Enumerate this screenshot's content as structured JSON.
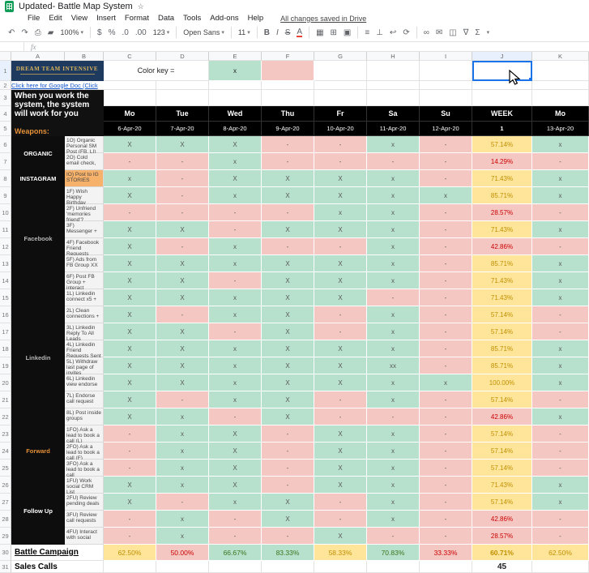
{
  "titlebar": {
    "title": "Updated-  Battle Map System"
  },
  "menubar": {
    "items": [
      "File",
      "Edit",
      "View",
      "Insert",
      "Format",
      "Data",
      "Tools",
      "Add-ons",
      "Help"
    ],
    "saved_status": "All changes saved in Drive"
  },
  "toolbar": {
    "zoom": "100%",
    "font_name": "Open Sans",
    "font_size": "11"
  },
  "formula": {
    "fx": "fx"
  },
  "icons": {
    "star": "☆",
    "undo": "↶",
    "redo": "↷",
    "print": "⎙",
    "paint_format": "▰",
    "dollar": "$",
    "percent": "%",
    "dec_decrease": ".0",
    "dec_increase": ".00",
    "format_123": "123",
    "caret": "▾",
    "bold": "B",
    "italic": "I",
    "strikethrough": "S",
    "text_color": "A",
    "fill_color": "▦",
    "borders": "⊞",
    "merge_cells": "▣",
    "align_horizontal": "≡",
    "align_vertical": "⊥",
    "text_wrap": "↩",
    "text_rotate": "⟳",
    "insert_link": "∞",
    "insert_comment": "✉",
    "insert_chart": "◫",
    "filter": "∇",
    "functions": "Σ"
  },
  "colors": {
    "green": "#b7e1cd",
    "pink": "#f4c7c3",
    "yellow": "#ffe599",
    "selection": "#1a73e8",
    "link": "#1155cc",
    "orange_label": "#e69138",
    "instagram_bg": "#f6b26b",
    "navy": "#1f3a5f",
    "gold": "#d9b45b"
  },
  "sheet": {
    "col_headers": [
      "A",
      "B",
      "C",
      "D",
      "E",
      "F",
      "G",
      "H",
      "I",
      "J",
      "K"
    ],
    "color_key_label": "Color key =",
    "color_key_x": "x",
    "logo_text": "DREAM TEAM INTENSIVE",
    "link_text": "Click here for Google Doc (Click",
    "quote": "When you work the system, the system will work for you",
    "weapons_label": "Weapons:",
    "day_headers": [
      "Mo",
      "Tue",
      "Wed",
      "Thu",
      "Fr",
      "Sa",
      "Su",
      "WEEK",
      "Mo"
    ],
    "date_row": [
      "6-Apr-20",
      "7-Apr-20",
      "8-Apr-20",
      "9-Apr-20",
      "10-Apr-20",
      "11-Apr-20",
      "12-Apr-20",
      "1",
      "13-Apr-20"
    ],
    "rows": [
      {
        "num": "6",
        "group": "ORGANIC",
        "group_span": 2,
        "group_color": "#ffffff",
        "weapon": "1O) Organic Personal SM Post (FB, LI)",
        "cells": [
          "X",
          "X",
          "X",
          "-",
          "-",
          "x",
          "-"
        ],
        "week": "57.14%",
        "week_tone": "yellow",
        "mon2": "x"
      },
      {
        "num": "7",
        "weapon": "2O) Cold email check,",
        "cells": [
          "-",
          "-",
          "x",
          "-",
          "-",
          "-",
          "-"
        ],
        "week": "14.29%",
        "week_tone": "pink",
        "mon2": "-"
      },
      {
        "num": "8",
        "group": "INSTAGRAM",
        "group_span": 1,
        "group_color": "#ffffff",
        "weapon": "IO) Post to IG STORIES",
        "weapon_bg": "orange",
        "cells": [
          "x",
          "-",
          "X",
          "X",
          "X",
          "x",
          "-"
        ],
        "week": "71.43%",
        "week_tone": "yellow",
        "mon2": "x"
      },
      {
        "num": "9",
        "group": "Facebook",
        "group_span": 6,
        "group_color": "#b7b7b7",
        "weapon": "1F) Wish Happy Birthday",
        "cells": [
          "X",
          "-",
          "x",
          "X",
          "X",
          "x",
          "x"
        ],
        "week": "85.71%",
        "week_tone": "yellow",
        "mon2": "x"
      },
      {
        "num": "10",
        "weapon": "2F) Unfriend 'memories friend'?",
        "cells": [
          "-",
          "-",
          "-",
          "-",
          "x",
          "x",
          "-"
        ],
        "week": "28.57%",
        "week_tone": "pink",
        "mon2": "-"
      },
      {
        "num": "11",
        "weapon": "3F) Messenger +",
        "cells": [
          "X",
          "X",
          "-",
          "X",
          "X",
          "x",
          "-"
        ],
        "week": "71.43%",
        "week_tone": "yellow",
        "mon2": "x"
      },
      {
        "num": "12",
        "weapon": "4F) Facebook Friend Requests",
        "cells": [
          "X",
          "-",
          "x",
          "-",
          "-",
          "x",
          "-"
        ],
        "week": "42.86%",
        "week_tone": "pink",
        "mon2": "-"
      },
      {
        "num": "13",
        "weapon": "5F) Ads from FB Group XX",
        "cells": [
          "X",
          "X",
          "x",
          "X",
          "X",
          "x",
          "-"
        ],
        "week": "85.71%",
        "week_tone": "yellow",
        "mon2": "x"
      },
      {
        "num": "14",
        "weapon": "6F) Post FB Group + interact",
        "cells": [
          "X",
          "X",
          "-",
          "X",
          "X",
          "x",
          "-"
        ],
        "week": "71.43%",
        "week_tone": "yellow",
        "mon2": "x"
      },
      {
        "num": "15",
        "group": "Linkedin",
        "group_span": 8,
        "group_color": "#b7b7b7",
        "weapon": "1L) Linkedin connect x5 +",
        "cells": [
          "X",
          "X",
          "x",
          "X",
          "X",
          "-",
          "-"
        ],
        "week": "71.43%",
        "week_tone": "yellow",
        "mon2": "x"
      },
      {
        "num": "16",
        "weapon": "2L) Clean connections +",
        "cells": [
          "X",
          "-",
          "x",
          "X",
          "-",
          "x",
          "-"
        ],
        "week": "57.14%",
        "week_tone": "yellow",
        "mon2": "-"
      },
      {
        "num": "17",
        "weapon": "3L) Linkedin Reply To All Leads",
        "cells": [
          "X",
          "X",
          "-",
          "X",
          "-",
          "x",
          "-"
        ],
        "week": "57.14%",
        "week_tone": "yellow",
        "mon2": "-"
      },
      {
        "num": "18",
        "weapon": "4L) Linkedin Friend Requests Sent",
        "cells": [
          "X",
          "X",
          "x",
          "X",
          "X",
          "x",
          "-"
        ],
        "week": "85.71%",
        "week_tone": "yellow",
        "mon2": "x"
      },
      {
        "num": "19",
        "weapon": "5L) Withdraw last page of invites",
        "cells": [
          "X",
          "X",
          "x",
          "X",
          "X",
          "xx",
          "-"
        ],
        "week": "85.71%",
        "week_tone": "yellow",
        "mon2": "x"
      },
      {
        "num": "20",
        "weapon": "6L) Linkedin view endorse",
        "cells": [
          "X",
          "X",
          "x",
          "X",
          "X",
          "x",
          "x"
        ],
        "week": "100.00%",
        "week_tone": "yellow",
        "mon2": "x"
      },
      {
        "num": "21",
        "weapon": "7L) Endorse call request",
        "cells": [
          "X",
          "-",
          "x",
          "X",
          "-",
          "x",
          "-"
        ],
        "week": "57.14%",
        "week_tone": "yellow",
        "mon2": "-"
      },
      {
        "num": "22",
        "weapon": "8L) Post inside groups",
        "cells": [
          "X",
          "x",
          "-",
          "X",
          "-",
          "-",
          "-"
        ],
        "week": "42.86%",
        "week_tone": "pink",
        "mon2": "x"
      },
      {
        "num": "23",
        "group": "Forward",
        "group_span": 3,
        "group_color": "#e69138",
        "weapon": "1FO) Ask a lead to book a call (L)",
        "cells": [
          "-",
          "x",
          "X",
          "-",
          "X",
          "x",
          "-"
        ],
        "week": "57.14%",
        "week_tone": "yellow",
        "mon2": "-"
      },
      {
        "num": "24",
        "weapon": "2FO) Ask a lead to book a call (F)",
        "cells": [
          "-",
          "x",
          "X",
          "-",
          "X",
          "x",
          "-"
        ],
        "week": "57.14%",
        "week_tone": "yellow",
        "mon2": "-"
      },
      {
        "num": "25",
        "weapon": "3FO) Ask a lead to book a call",
        "cells": [
          "-",
          "x",
          "X",
          "-",
          "X",
          "x",
          "-"
        ],
        "week": "57.14%",
        "week_tone": "yellow",
        "mon2": "-"
      },
      {
        "num": "26",
        "group": "Follow Up",
        "group_span": 4,
        "group_color": "#ffffff",
        "weapon": "1FU) Work social CRM List",
        "cells": [
          "X",
          "x",
          "X",
          "-",
          "X",
          "x",
          "-"
        ],
        "week": "71.43%",
        "week_tone": "yellow",
        "mon2": "x"
      },
      {
        "num": "27",
        "weapon": "2FU) Review pending deals",
        "cells": [
          "X",
          "-",
          "x",
          "X",
          "-",
          "x",
          "-"
        ],
        "week": "57.14%",
        "week_tone": "yellow",
        "mon2": "x"
      },
      {
        "num": "28",
        "weapon": "3FU) Review call requests",
        "cells": [
          "-",
          "x",
          "-",
          "X",
          "-",
          "x",
          "-"
        ],
        "week": "42.86%",
        "week_tone": "pink",
        "mon2": "-"
      },
      {
        "num": "29",
        "weapon": "4FU) Interact with social",
        "cells": [
          "-",
          "x",
          "-",
          "-",
          "X",
          "-",
          "-"
        ],
        "week": "28.57%",
        "week_tone": "pink",
        "mon2": "-"
      }
    ],
    "battle_row": {
      "num": "30",
      "label": "Battle Campaign",
      "values": [
        "62.50%",
        "50.00%",
        "66.67%",
        "83.33%",
        "58.33%",
        "70.83%",
        "33.33%",
        "60.71%",
        "62.50%"
      ],
      "tones": [
        "yellow",
        "pink",
        "green",
        "green",
        "yellow",
        "green",
        "pink",
        "yellow",
        "yellow"
      ]
    },
    "sales_row": {
      "num": "31",
      "label": "Sales Calls",
      "week_value": "45"
    }
  }
}
